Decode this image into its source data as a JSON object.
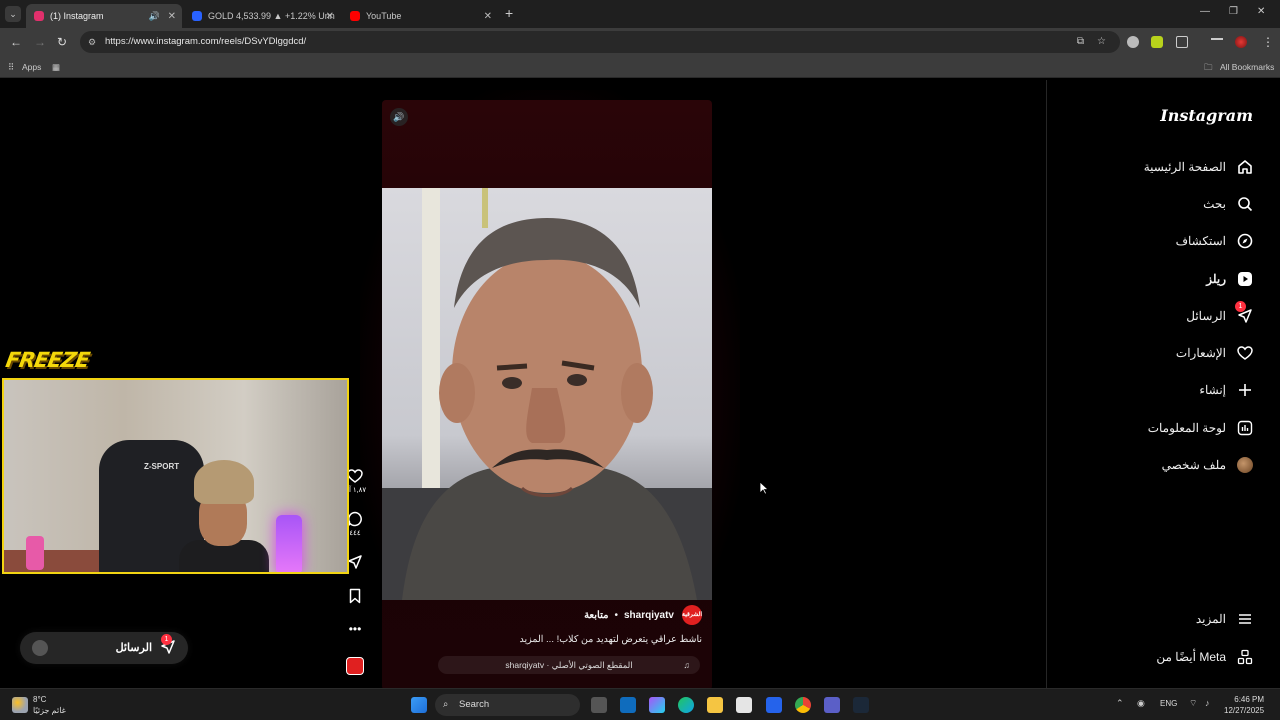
{
  "browser": {
    "tabs": [
      {
        "title": "(1) Instagram",
        "favicon_color": "#e1306c",
        "active": true
      },
      {
        "title": "GOLD 4,533.99 ▲ +1.22% Unn",
        "favicon_color": "#2962ff",
        "active": false
      },
      {
        "title": "YouTube",
        "favicon_color": "#ff0000",
        "active": false
      }
    ],
    "url": "https://www.instagram.com/reels/DSvYDlggdcd/",
    "bookmarks": {
      "apps": "Apps",
      "all": "All Bookmarks"
    }
  },
  "sidebar": {
    "logo": "Instagram",
    "items": [
      {
        "label": "الصفحة الرئيسية",
        "icon": "home-icon"
      },
      {
        "label": "بحث",
        "icon": "search-icon"
      },
      {
        "label": "استكشاف",
        "icon": "compass-icon"
      },
      {
        "label": "ريلز",
        "icon": "reels-icon",
        "active": true
      },
      {
        "label": "الرسائل",
        "icon": "messenger-icon",
        "badge": "1"
      },
      {
        "label": "الإشعارات",
        "icon": "heart-icon"
      },
      {
        "label": "إنشاء",
        "icon": "plus-icon"
      },
      {
        "label": "لوحة المعلومات",
        "icon": "dashboard-icon"
      },
      {
        "label": "ملف شخصي",
        "icon": "avatar-icon"
      }
    ],
    "more": "المزيد",
    "meta": "أيضًا من Meta"
  },
  "reel": {
    "username": "sharqiyatv",
    "follow": "متابعة",
    "channel_logo": "الشرقية",
    "caption": "ناشط عراقي يتعرض لتهديد من كلاب! ... المزيد",
    "audio": "sharqiyatv · المقطع الصوتي الأصلي",
    "likes": "١,٨٧ آلا",
    "comments": "٤٤٤"
  },
  "overlay": {
    "brand": "FREEZE",
    "chair_label": "Z-SPORT"
  },
  "messages_pill": {
    "label": "الرسائل",
    "badge": "1"
  },
  "taskbar": {
    "weather_temp": "8°C",
    "weather_desc": "غائم جزئيًا",
    "search": "Search",
    "lang": "ENG",
    "time": "6:46 PM",
    "date": "12/27/2025"
  }
}
